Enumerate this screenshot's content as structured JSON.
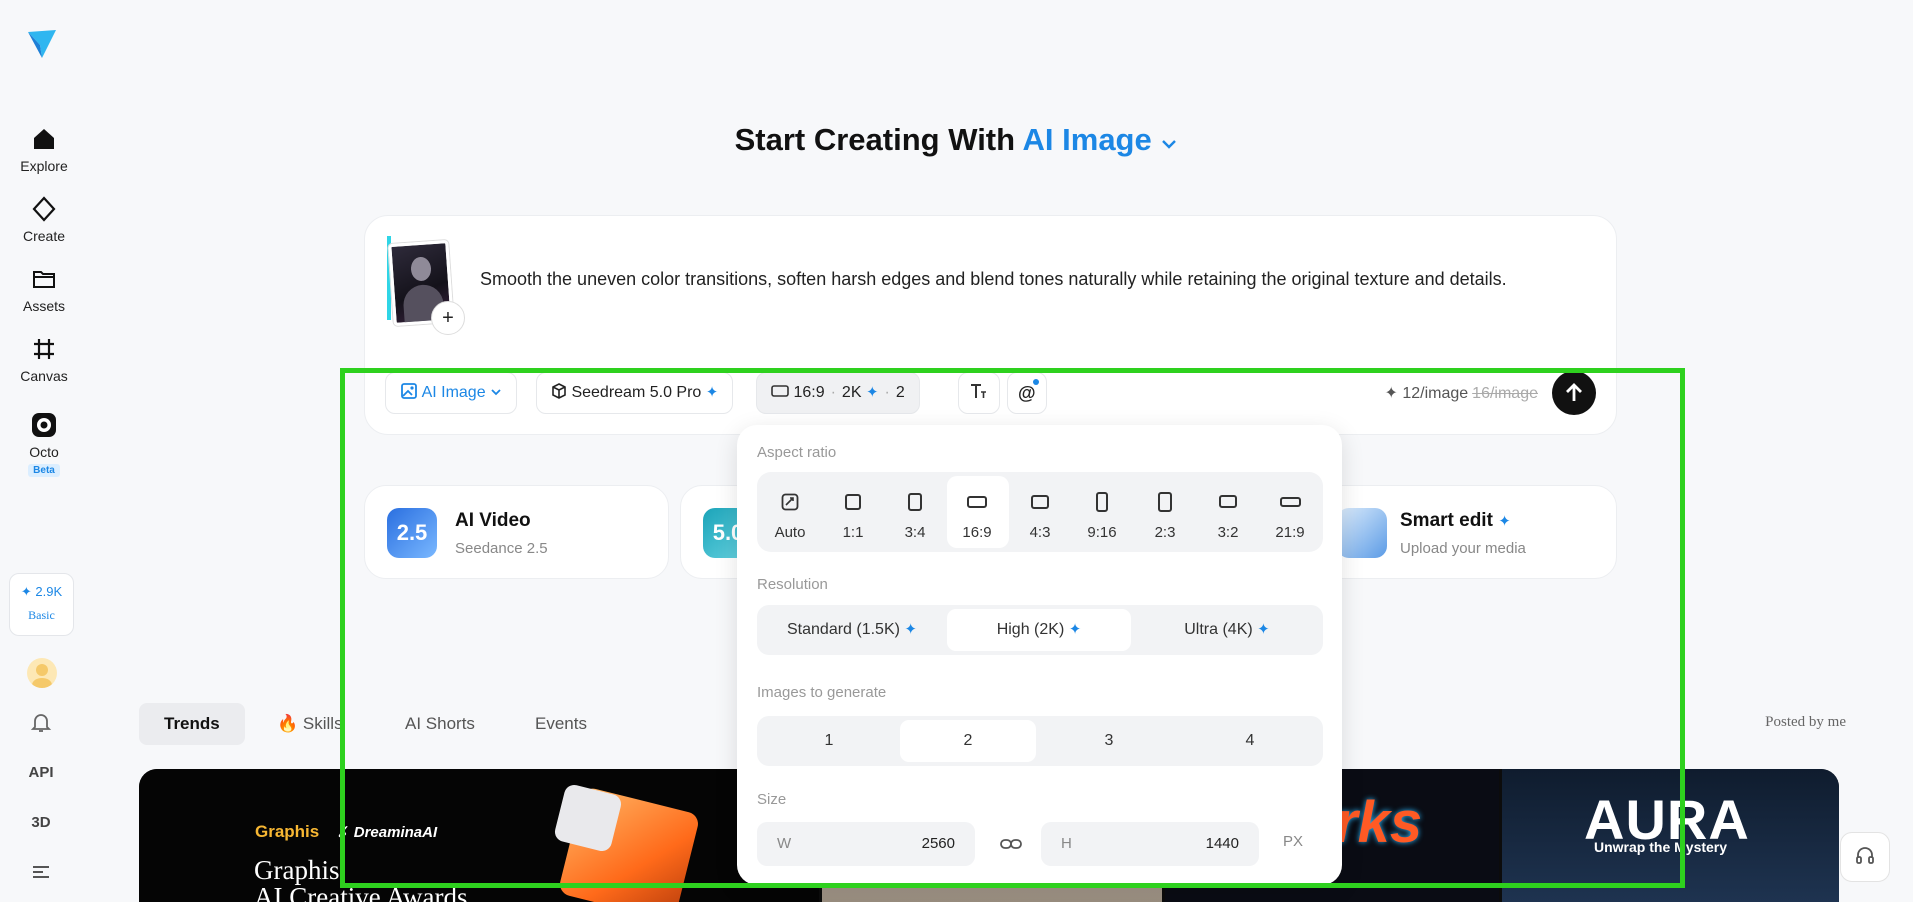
{
  "sidebar": {
    "items": [
      {
        "label": "Explore",
        "icon": "home-icon"
      },
      {
        "label": "Create",
        "icon": "create-icon"
      },
      {
        "label": "Assets",
        "icon": "folder-icon"
      },
      {
        "label": "Canvas",
        "icon": "canvas-icon"
      },
      {
        "label": "Octo",
        "icon": "octo-icon",
        "badge": "Beta"
      }
    ],
    "credits": {
      "amount": "2.9K",
      "plan": "Basic"
    },
    "bottom": {
      "api": "API",
      "threed": "3D"
    }
  },
  "headline": {
    "prefix": "Start Creating With",
    "accent": "AI Image"
  },
  "prompt": {
    "text": "Smooth the uneven color transitions, soften harsh edges and blend tones naturally while retaining the original texture and details.",
    "add": "+"
  },
  "toolbar": {
    "mode": "AI Image",
    "model": "Seedream 5.0 Pro",
    "ratio": "16:9",
    "resolution": "2K",
    "count": "2",
    "price": "12/image",
    "price_old": "16/image"
  },
  "features": [
    {
      "title": "AI Video",
      "subtitle": "Seedance 2.5",
      "badge": "2.5"
    },
    {
      "badge": "5.0"
    },
    {
      "title": "Smart edit",
      "subtitle": "Upload your media"
    }
  ],
  "tabs": [
    "Trends",
    "Skills",
    "AI Shorts",
    "Events"
  ],
  "posted_by": "Posted by me",
  "banner": {
    "brand": "Graphis",
    "partner": "DreaminaAI",
    "heading_line1": "Graphis",
    "heading_line2": "AI Creative Awards",
    "aura": "AURA",
    "aura_sub": "Unwrap the Mystery"
  },
  "panel": {
    "aspect_label": "Aspect ratio",
    "ratios": [
      "Auto",
      "1:1",
      "3:4",
      "16:9",
      "4:3",
      "9:16",
      "2:3",
      "3:2",
      "21:9"
    ],
    "selected_ratio": "16:9",
    "resolution_label": "Resolution",
    "resolutions": [
      "Standard (1.5K)",
      "High (2K)",
      "Ultra (4K)"
    ],
    "selected_resolution": "High (2K)",
    "count_label": "Images to generate",
    "counts": [
      "1",
      "2",
      "3",
      "4"
    ],
    "selected_count": "2",
    "size_label": "Size",
    "width_key": "W",
    "width": "2560",
    "height_key": "H",
    "height": "1440",
    "unit": "PX"
  },
  "colors": {
    "accent": "#1c87e5",
    "highlight": "#2ed11e"
  }
}
